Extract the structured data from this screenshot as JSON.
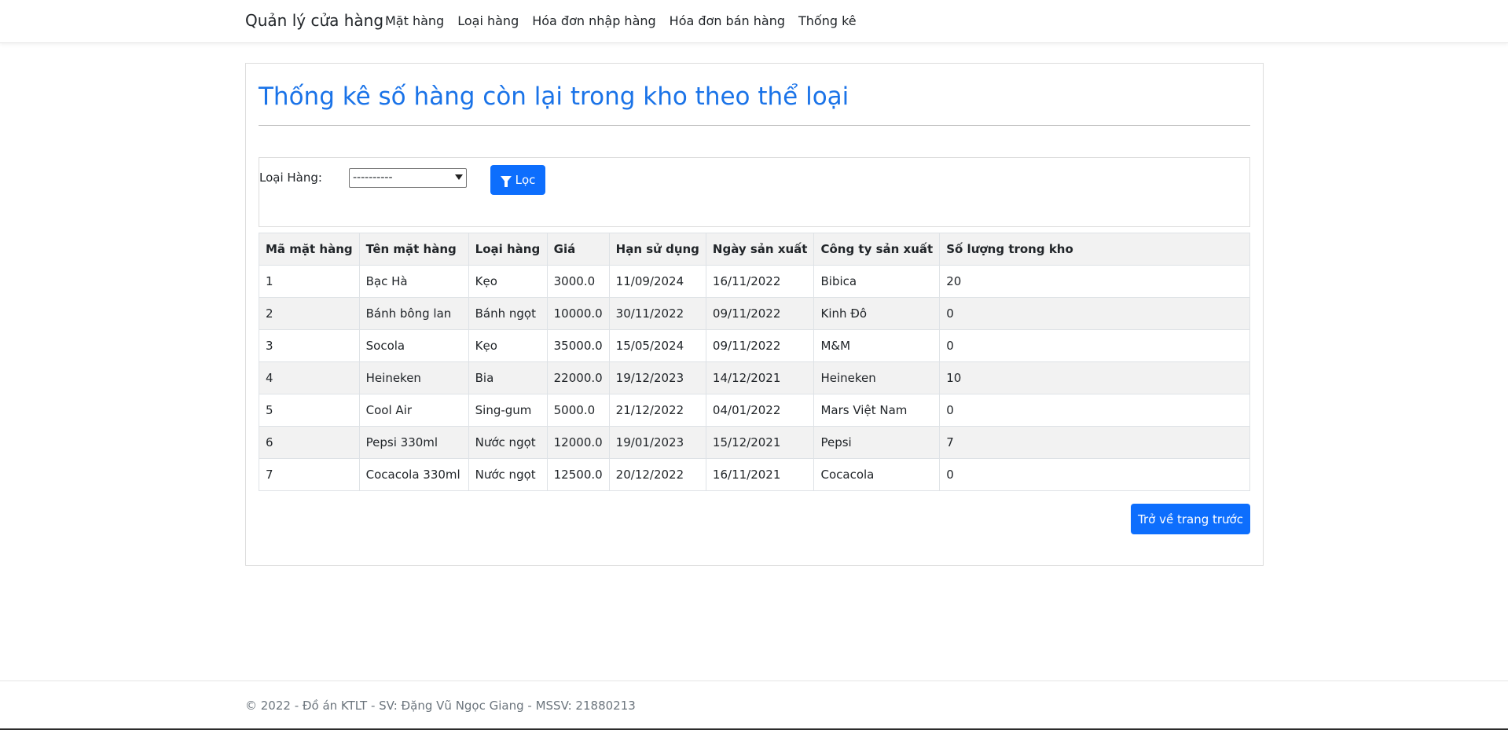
{
  "navbar": {
    "brand": "Quản lý cửa hàng",
    "links": [
      "Mặt hàng",
      "Loại hàng",
      "Hóa đơn nhập hàng",
      "Hóa đơn bán hàng",
      "Thống kê"
    ]
  },
  "page": {
    "title": "Thống kê số hàng còn lại trong kho theo thể loại"
  },
  "filter": {
    "label": "Loại Hàng:",
    "selected": "----------",
    "button_label": "Lọc",
    "button_icon": "filter-icon"
  },
  "table": {
    "headers": [
      "Mã mặt hàng",
      "Tên mặt hàng",
      "Loại hàng",
      "Giá",
      "Hạn sử dụng",
      "Ngày sản xuất",
      "Công ty sản xuất",
      "Số lượng trong kho"
    ],
    "rows": [
      [
        "1",
        "Bạc Hà",
        "Kẹo",
        "3000.0",
        "11/09/2024",
        "16/11/2022",
        "Bibica",
        "20"
      ],
      [
        "2",
        "Bánh bông lan",
        "Bánh ngọt",
        "10000.0",
        "30/11/2022",
        "09/11/2022",
        "Kinh Đô",
        "0"
      ],
      [
        "3",
        "Socola",
        "Kẹo",
        "35000.0",
        "15/05/2024",
        "09/11/2022",
        "M&M",
        "0"
      ],
      [
        "4",
        "Heineken",
        "Bia",
        "22000.0",
        "19/12/2023",
        "14/12/2021",
        "Heineken",
        "10"
      ],
      [
        "5",
        "Cool Air",
        "Sing-gum",
        "5000.0",
        "21/12/2022",
        "04/01/2022",
        "Mars Việt Nam",
        "0"
      ],
      [
        "6",
        "Pepsi 330ml",
        "Nước ngọt",
        "12000.0",
        "19/01/2023",
        "15/12/2021",
        "Pepsi",
        "7"
      ],
      [
        "7",
        "Cocacola 330ml",
        "Nước ngọt",
        "12500.0",
        "20/12/2022",
        "16/11/2021",
        "Cocacola",
        "0"
      ]
    ]
  },
  "back_button": "Trở về trang trước",
  "footer": "© 2022 - Đồ án KTLT - SV: Đặng Vũ Ngọc Giang - MSSV: 21880213",
  "colors": {
    "primary": "#0d6efd",
    "title": "#1a73e8"
  }
}
